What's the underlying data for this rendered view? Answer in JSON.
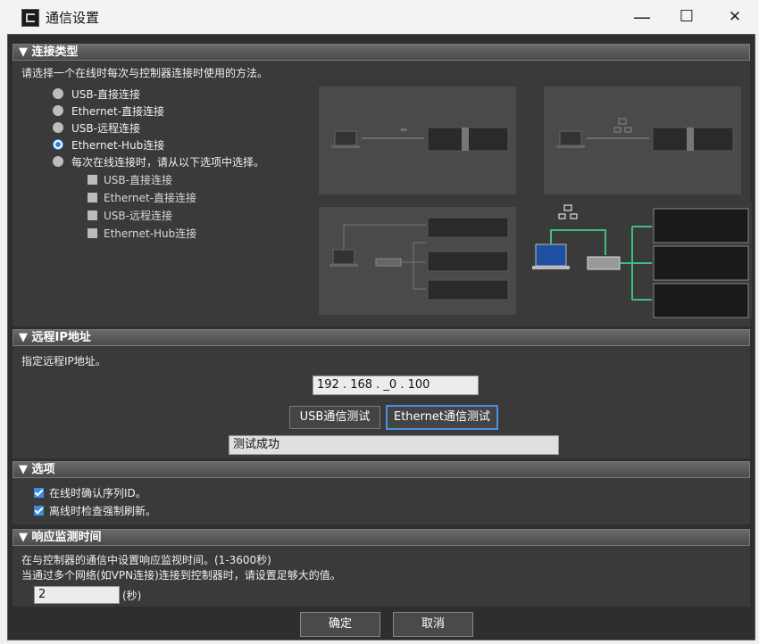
{
  "window": {
    "title": "通信设置",
    "minimize": "—",
    "maximize": "☐",
    "close": "✕"
  },
  "connection_type": {
    "header": "▼ 连接类型",
    "instruction": "请选择一个在线时每次与控制器连接时使用的方法。",
    "options": [
      {
        "label": "USB-直接连接",
        "selected": false
      },
      {
        "label": "Ethernet-直接连接",
        "selected": false
      },
      {
        "label": "USB-远程连接",
        "selected": false
      },
      {
        "label": "Ethernet-Hub连接",
        "selected": true
      },
      {
        "label": "每次在线连接时，请从以下选项中选择。",
        "selected": false
      }
    ],
    "sub_options": [
      {
        "label": "USB-直接连接",
        "checked": false
      },
      {
        "label": "Ethernet-直接连接",
        "checked": false
      },
      {
        "label": "USB-远程连接",
        "checked": false
      },
      {
        "label": "Ethernet-Hub连接",
        "checked": false
      }
    ]
  },
  "remote_ip": {
    "header": "▼ 远程IP地址",
    "instruction": "指定远程IP地址。",
    "ip_value": "192 . 168 . _0 . 100",
    "usb_test_label": "USB通信测试",
    "ethernet_test_label": "Ethernet通信测试",
    "result": "测试成功"
  },
  "options": {
    "header": "▼ 选项",
    "items": [
      {
        "label": "在线时确认序列ID。",
        "checked": true
      },
      {
        "label": "离线时检查强制刷新。",
        "checked": true
      }
    ]
  },
  "response": {
    "header": "▼ 响应监测时间",
    "line1": "在与控制器的通信中设置响应监视时间。(1-3600秒)",
    "line2": "当通过多个网络(如VPN连接)连接到控制器时，请设置足够大的值。",
    "value": "2",
    "unit": "(秒)"
  },
  "footer": {
    "ok_label": "确定",
    "cancel_label": "取消"
  }
}
